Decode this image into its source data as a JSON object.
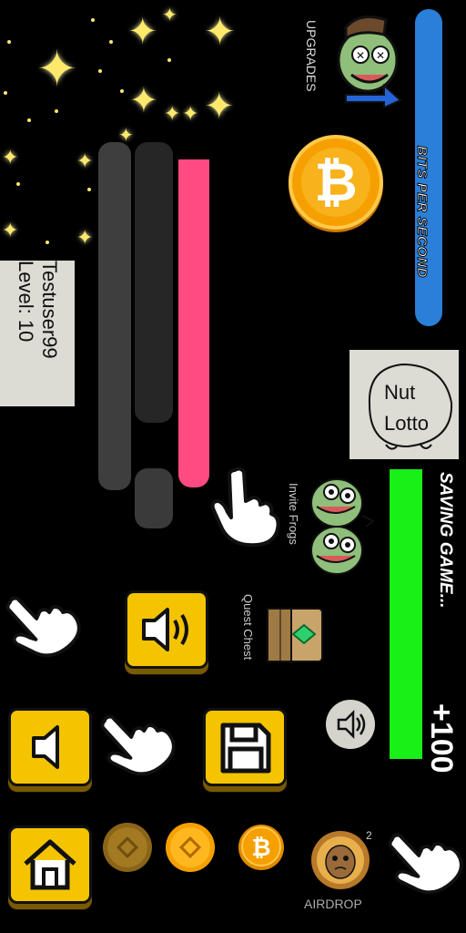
{
  "player": {
    "name": "Testuser99",
    "level_text": "Level: 10"
  },
  "upgrades": {
    "label": "UPGRADES"
  },
  "bits_per_second": {
    "label": "BITS PER SECOND"
  },
  "nut_lotto": {
    "line1": "Nut",
    "line2": "Lotto"
  },
  "invite_frogs": {
    "label": "Invite Frogs"
  },
  "quest_chest": {
    "label": "Quest Chest"
  },
  "saving": {
    "label": "SAVING GAME...",
    "bonus": "+100"
  },
  "airdrop": {
    "label": "AIRDROP",
    "count": "2"
  },
  "colors": {
    "bps_bar": "#2a7fd8",
    "save_bar": "#18f018",
    "pink_bar": "#ff4b82",
    "button_yellow": "#f4c400",
    "coin_orange": "#f5a000"
  },
  "icons": [
    "star-icon",
    "frog-upgrade-icon",
    "bitcoin-coin-icon",
    "hand-pointer-icon",
    "speaker-icon",
    "speaker-muted-icon",
    "save-icon",
    "home-icon",
    "binance-coin-icon",
    "airdrop-icon",
    "quest-chest-icon",
    "invite-frogs-icon"
  ]
}
